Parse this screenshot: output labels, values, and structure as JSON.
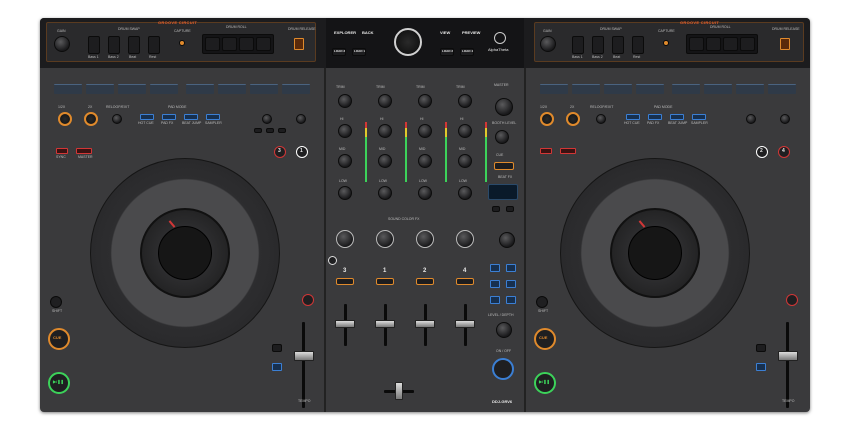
{
  "left_deck": {
    "brand": "GROOVE CIRCUIT",
    "section_labels": [
      "DRUM SWAP",
      "CAPTURE",
      "DRUM ROLL",
      "DRUM RELEASE"
    ],
    "knob_label": "GAIN",
    "pad_labels": [
      "Bass 1",
      "Bass 2",
      "Beat",
      "Rest"
    ],
    "loop_labels": [
      "1/2X",
      "2X",
      "RELOOP/EXIT",
      "PAD MODE"
    ],
    "mode_labels": [
      "HOT CUE",
      "PAD FX",
      "BEAT JUMP",
      "SAMPLER"
    ],
    "sync_labels": [
      "SYNC",
      "MASTER"
    ],
    "shift_label": "SHIFT",
    "cue_label": "CUE",
    "play_label": "▶/❚❚",
    "tempo_label": "TEMPO",
    "deck_numbers": [
      "3",
      "1"
    ],
    "cue_text": "CUE"
  },
  "center": {
    "rekordbox_tabs": [
      "EXPLORER",
      "BACK",
      "VIEW",
      "PREVIEW"
    ],
    "load_labels": [
      "LOAD 3",
      "LOAD 1",
      "LOAD 2",
      "LOAD 4"
    ],
    "alphatheta": "AlphaTheta",
    "eq_labels": [
      "TRIM",
      "HI",
      "MID",
      "LOW",
      "CFX"
    ],
    "channel_numbers": [
      "3",
      "1",
      "2",
      "4"
    ],
    "master_label": "MASTER",
    "booth_label": "BOOTH LEVEL",
    "beat_fx": "BEAT FX",
    "sound_color_fx": "SOUND COLOR FX",
    "level_depth": "LEVEL / DEPTH",
    "on_off": "ON / OFF",
    "model": "DDJ-GRV6",
    "cue_label": "CUE"
  },
  "right_deck": {
    "brand": "GROOVE CIRCUIT",
    "section_labels": [
      "DRUM SWAP",
      "CAPTURE",
      "DRUM ROLL",
      "DRUM RELEASE"
    ],
    "knob_label": "GAIN",
    "pad_labels": [
      "Bass 1",
      "Bass 2",
      "Beat",
      "Rest"
    ],
    "loop_labels": [
      "1/2X",
      "2X",
      "RELOOP/EXIT",
      "PAD MODE"
    ],
    "mode_labels": [
      "HOT CUE",
      "PAD FX",
      "BEAT JUMP",
      "SAMPLER"
    ],
    "shift_label": "SHIFT",
    "cue_label": "CUE",
    "play_label": "▶/❚❚",
    "tempo_label": "TEMPO",
    "deck_numbers": [
      "2",
      "4"
    ]
  },
  "colors": {
    "accent": "#e8602c",
    "blue": "#3b7fd4",
    "red": "#d23636",
    "orange": "#e08a2c"
  }
}
